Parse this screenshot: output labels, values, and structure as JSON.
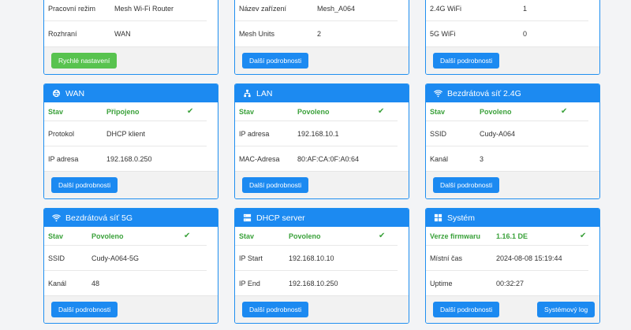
{
  "top": {
    "col1": {
      "rows": [
        {
          "k": "Pracovní režim",
          "v": "Mesh Wi-Fi Router"
        },
        {
          "k": "Rozhraní",
          "v": "WAN"
        }
      ],
      "button": "Rychlé nastavení"
    },
    "col2": {
      "rows": [
        {
          "k": "Název zařízení",
          "v": "Mesh_A064"
        },
        {
          "k": "Mesh Units",
          "v": "2"
        }
      ],
      "button": "Další podrobnosti"
    },
    "col3": {
      "rows": [
        {
          "k": "2.4G WiFi",
          "v": "1"
        },
        {
          "k": "5G WiFi",
          "v": "0"
        }
      ],
      "button": "Další podrobnosti"
    }
  },
  "cards": {
    "wan": {
      "title": "WAN",
      "status_k": "Stav",
      "status_v": "Připojeno",
      "rows": [
        {
          "k": "Protokol",
          "v": "DHCP klient"
        },
        {
          "k": "IP adresa",
          "v": "192.168.0.250"
        }
      ],
      "button": "Další podrobnosti"
    },
    "lan": {
      "title": "LAN",
      "status_k": "Stav",
      "status_v": "Povoleno",
      "rows": [
        {
          "k": "IP adresa",
          "v": "192.168.10.1"
        },
        {
          "k": "MAC-Adresa",
          "v": "80:AF:CA:0F:A0:64"
        }
      ],
      "button": "Další podrobnosti"
    },
    "w24": {
      "title": "Bezdrátová síť 2.4G",
      "status_k": "Stav",
      "status_v": "Povoleno",
      "rows": [
        {
          "k": "SSID",
          "v": "Cudy-A064"
        },
        {
          "k": "Kanál",
          "v": "3"
        }
      ],
      "button": "Další podrobnosti"
    },
    "w5": {
      "title": "Bezdrátová síť 5G",
      "status_k": "Stav",
      "status_v": "Povoleno",
      "rows": [
        {
          "k": "SSID",
          "v": "Cudy-A064-5G"
        },
        {
          "k": "Kanál",
          "v": "48"
        }
      ],
      "button": "Další podrobnosti"
    },
    "dhcp": {
      "title": "DHCP server",
      "status_k": "Stav",
      "status_v": "Povoleno",
      "rows": [
        {
          "k": "IP Start",
          "v": "192.168.10.10"
        },
        {
          "k": "IP End",
          "v": "192.168.10.250"
        }
      ],
      "button": "Další podrobnosti"
    },
    "sys": {
      "title": "Systém",
      "status_k": "Verze firmwaru",
      "status_v": "1.16.1 DE",
      "rows": [
        {
          "k": "Místní čas",
          "v": "2024-08-08 15:19:44"
        },
        {
          "k": "Uptime",
          "v": "00:32:27"
        }
      ],
      "button": "Další podrobnosti",
      "button2": "Systémový log"
    }
  },
  "icons": {
    "check": "✔"
  }
}
